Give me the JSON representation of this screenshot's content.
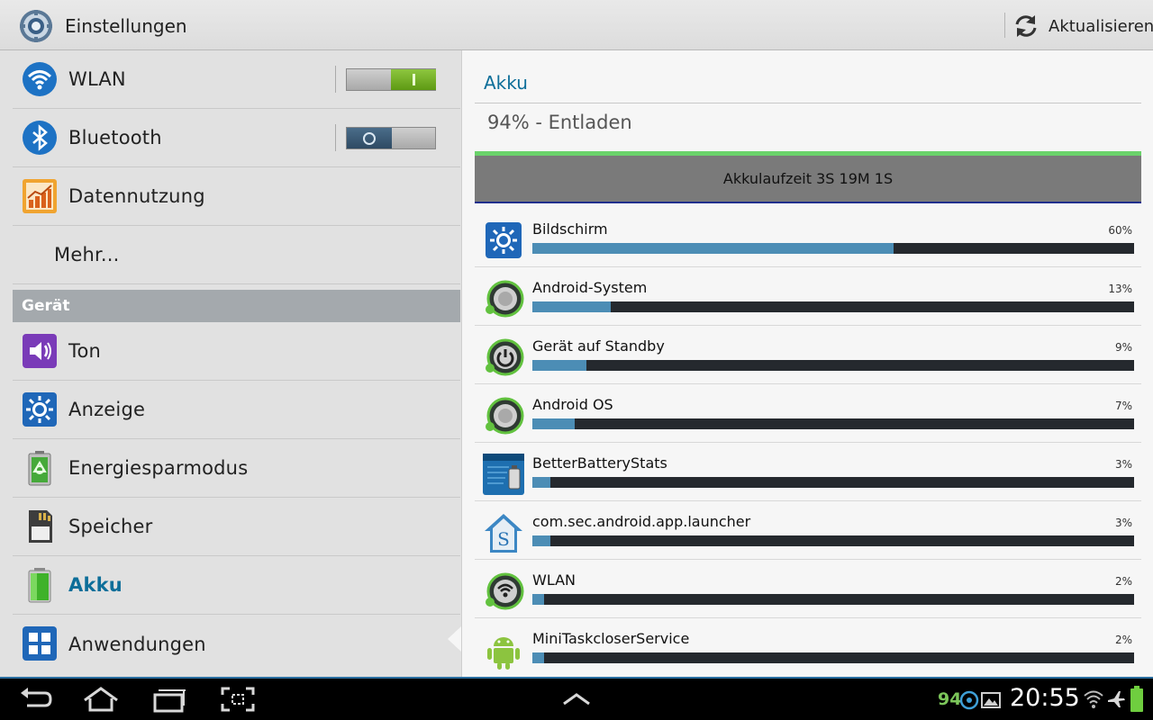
{
  "app": {
    "title": "Einstellungen",
    "refresh_label": "Aktualisieren"
  },
  "sidebar": {
    "items": [
      {
        "label": "WLAN",
        "icon": "wifi-icon",
        "toggle": "on"
      },
      {
        "label": "Bluetooth",
        "icon": "bluetooth-icon",
        "toggle": "off"
      },
      {
        "label": "Datennutzung",
        "icon": "data-usage-icon"
      },
      {
        "label": "Mehr..."
      }
    ],
    "section_header": "Gerät",
    "device_items": [
      {
        "label": "Ton",
        "icon": "sound-icon"
      },
      {
        "label": "Anzeige",
        "icon": "display-icon"
      },
      {
        "label": "Energiesparmodus",
        "icon": "power-saving-icon"
      },
      {
        "label": "Speicher",
        "icon": "storage-icon"
      },
      {
        "label": "Akku",
        "icon": "battery-icon",
        "selected": true
      },
      {
        "label": "Anwendungen",
        "icon": "apps-icon"
      }
    ]
  },
  "detail": {
    "title": "Akku",
    "status": "94% - Entladen",
    "graph_label": "Akkulaufzeit 3S 19M 1S",
    "usage": [
      {
        "name": "Bildschirm",
        "percent_label": "60%",
        "percent": 60,
        "icon": "screen-brightness-icon"
      },
      {
        "name": "Android-System",
        "percent_label": "13%",
        "percent": 13,
        "icon": "android-system-icon"
      },
      {
        "name": "Gerät auf Standby",
        "percent_label": "9%",
        "percent": 9,
        "icon": "standby-icon"
      },
      {
        "name": "Android OS",
        "percent_label": "7%",
        "percent": 7,
        "icon": "android-os-icon"
      },
      {
        "name": "BetterBatteryStats",
        "percent_label": "3%",
        "percent": 3,
        "icon": "betterbatterystats-icon"
      },
      {
        "name": "com.sec.android.app.launcher",
        "percent_label": "3%",
        "percent": 3,
        "icon": "launcher-icon"
      },
      {
        "name": "WLAN",
        "percent_label": "2%",
        "percent": 2,
        "icon": "wlan-icon"
      },
      {
        "name": "MiniTaskcloserService",
        "percent_label": "2%",
        "percent": 2,
        "icon": "android-robot-icon"
      }
    ]
  },
  "statusbar": {
    "battery_level": "94",
    "time": "20:55"
  },
  "colors": {
    "accent": "#0d6e99",
    "bar_fill": "#4c8db5",
    "bar_track": "#25292e",
    "toggle_on": "#6ea821",
    "battery_green": "#7cc65a"
  }
}
